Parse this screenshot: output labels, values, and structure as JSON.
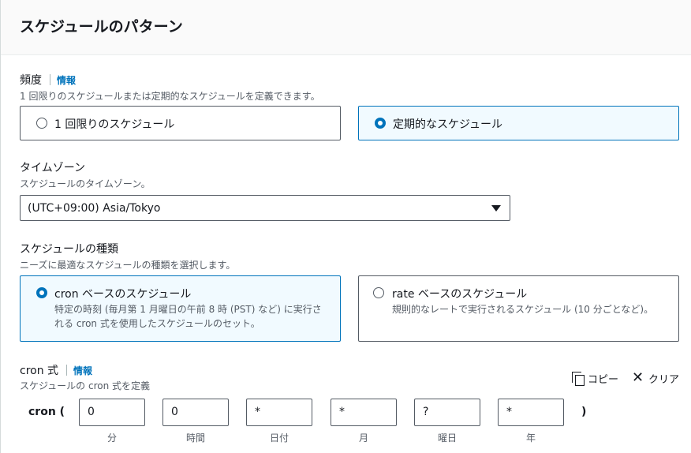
{
  "panel": {
    "title": "スケジュールのパターン"
  },
  "frequency": {
    "label": "頻度",
    "info": "情報",
    "description": "1 回限りのスケジュールまたは定期的なスケジュールを定義できます。",
    "options": [
      {
        "label": "1 回限りのスケジュール",
        "selected": false
      },
      {
        "label": "定期的なスケジュール",
        "selected": true
      }
    ]
  },
  "timezone": {
    "label": "タイムゾーン",
    "description": "スケジュールのタイムゾーン。",
    "value": "(UTC+09:00) Asia/Tokyo"
  },
  "schedule_type": {
    "label": "スケジュールの種類",
    "description": "ニーズに最適なスケジュールの種類を選択します。",
    "options": [
      {
        "label": "cron ベースのスケジュール",
        "description": "特定の時刻 (毎月第 1 月曜日の午前 8 時 (PST) など) に実行される cron 式を使用したスケジュールのセット。",
        "selected": true
      },
      {
        "label": "rate ベースのスケジュール",
        "description": "規則的なレートで実行されるスケジュール (10 分ごとなど)。",
        "selected": false
      }
    ]
  },
  "cron": {
    "label": "cron 式",
    "info": "情報",
    "description": "スケジュールの cron 式を定義",
    "copy_label": "コピー",
    "clear_label": "クリア",
    "prefix": "cron (",
    "suffix": ")",
    "fields": [
      {
        "value": "0",
        "label": "分"
      },
      {
        "value": "0",
        "label": "時間"
      },
      {
        "value": "*",
        "label": "日付"
      },
      {
        "value": "*",
        "label": "月"
      },
      {
        "value": "?",
        "label": "曜日"
      },
      {
        "value": "*",
        "label": "年"
      }
    ]
  },
  "colors": {
    "accent": "#0073bb",
    "selected_bg": "#f1faff",
    "text": "#16191f",
    "secondary_text": "#545b64"
  }
}
